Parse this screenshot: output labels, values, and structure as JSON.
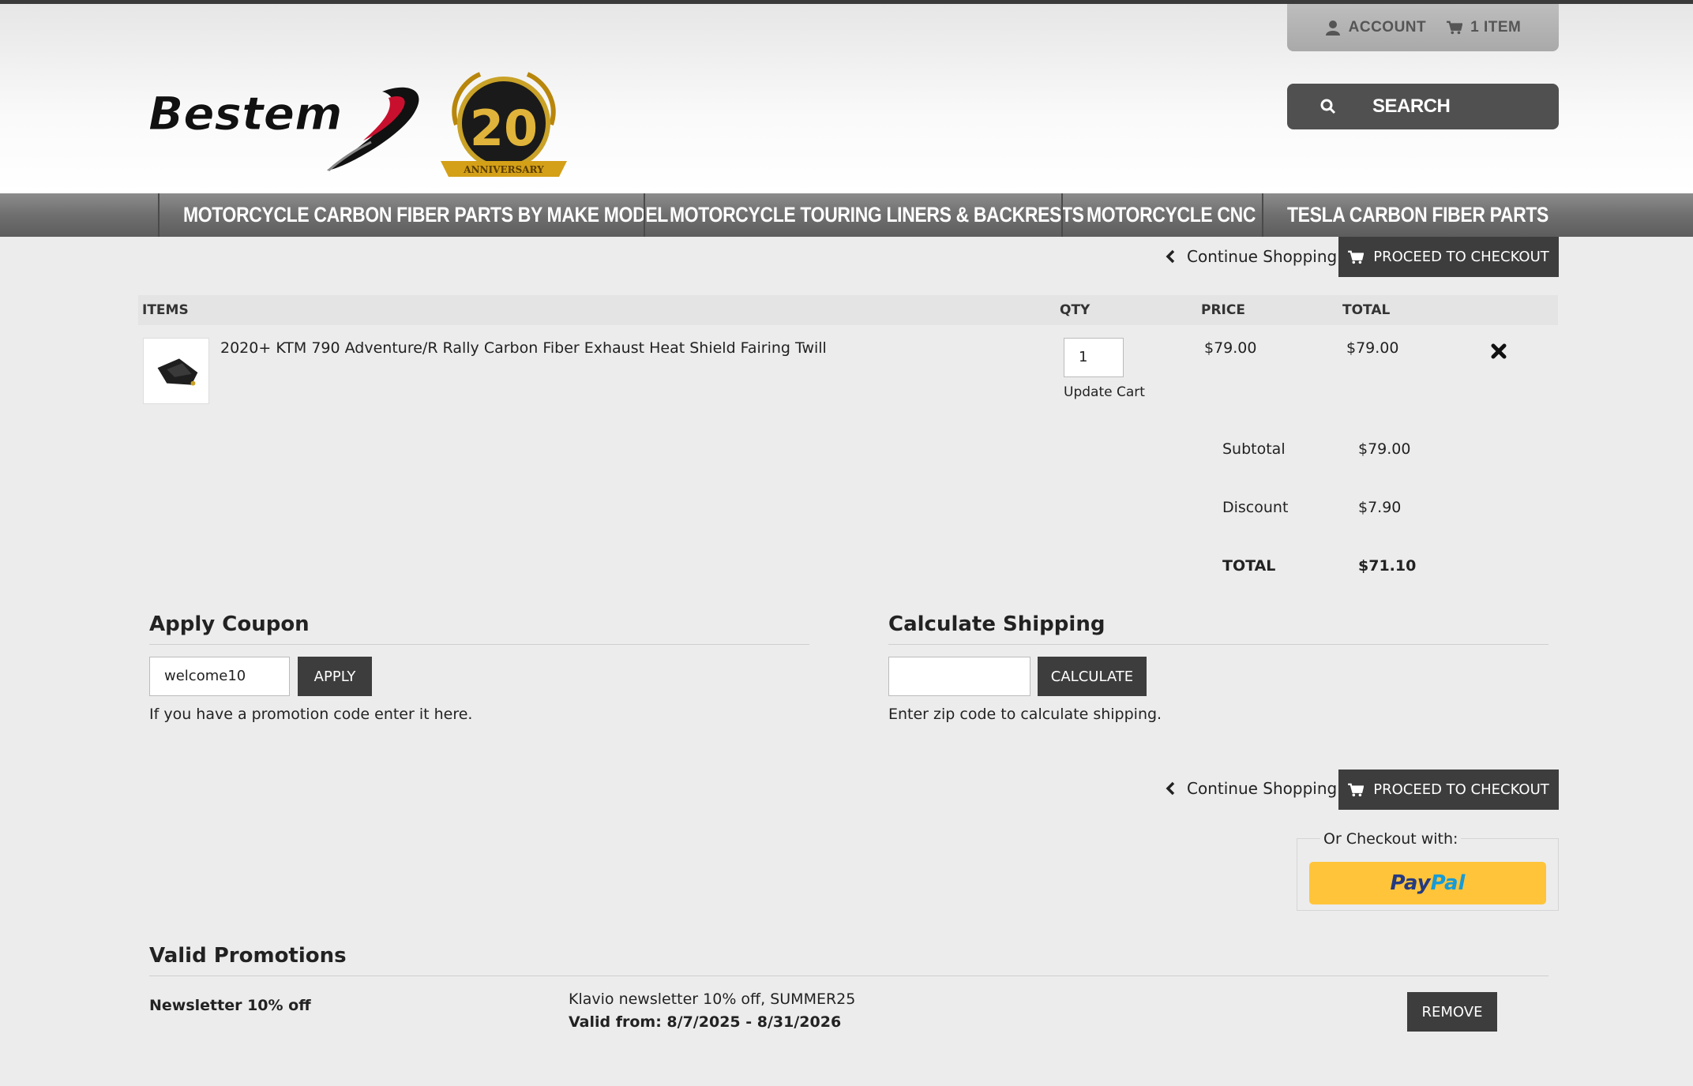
{
  "header": {
    "account_label": "ACCOUNT",
    "cart_label": "1 ITEM",
    "search_label": "SEARCH"
  },
  "nav": {
    "items": [
      "MOTORCYCLE CARBON FIBER PARTS BY MAKE MODEL",
      "MOTORCYCLE TOURING LINERS & BACKRESTS",
      "MOTORCYCLE CNC",
      "TESLA CARBON FIBER PARTS"
    ]
  },
  "actions": {
    "continue_label": "Continue Shopping",
    "checkout_label": "PROCEED TO CHECKOUT"
  },
  "table": {
    "headers": {
      "items": "ITEMS",
      "qty": "QTY",
      "price": "PRICE",
      "total": "TOTAL"
    },
    "rows": [
      {
        "name": "2020+ KTM 790 Adventure/R Rally Carbon Fiber Exhaust Heat Shield Fairing Twill",
        "qty": "1",
        "price": "$79.00",
        "total": "$79.00",
        "update_label": "Update Cart"
      }
    ]
  },
  "summary": {
    "subtotal_label": "Subtotal",
    "subtotal": "$79.00",
    "discount_label": "Discount",
    "discount": "$7.90",
    "total_label": "TOTAL",
    "total": "$71.10"
  },
  "coupon": {
    "title": "Apply Coupon",
    "value": "welcome10",
    "button": "APPLY",
    "help": "If you have a promotion code enter it here."
  },
  "shipping": {
    "title": "Calculate Shipping",
    "value": "",
    "button": "CALCULATE",
    "help": "Enter zip code to calculate shipping."
  },
  "alt_checkout": {
    "label": "Or Checkout with:",
    "paypal_part1": "Pay",
    "paypal_part2": "Pal"
  },
  "promotions": {
    "title": "Valid Promotions",
    "items": [
      {
        "name": "Newsletter 10% off",
        "description": "Klavio newsletter 10% off, SUMMER25",
        "valid": "Valid from: 8/7/2025 - 8/31/2026",
        "remove_label": "REMOVE"
      }
    ]
  },
  "colors": {
    "dark_button": "#3d3d3d",
    "nav_bg": "#6f6f6f",
    "paypal_yellow": "#ffc43a"
  }
}
